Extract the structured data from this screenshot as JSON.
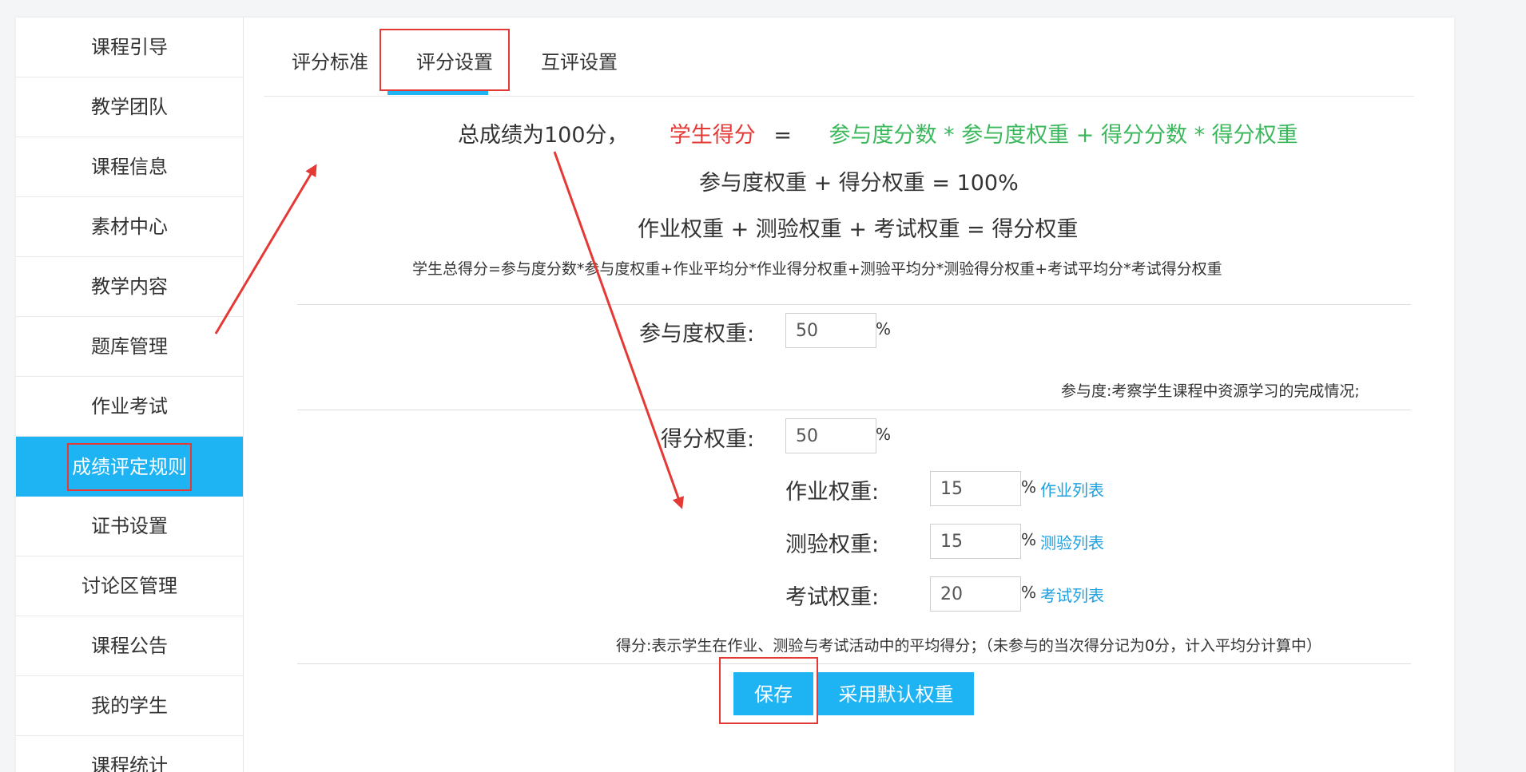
{
  "sidebar": {
    "items": [
      {
        "label": "课程引导",
        "active": false
      },
      {
        "label": "教学团队",
        "active": false
      },
      {
        "label": "课程信息",
        "active": false
      },
      {
        "label": "素材中心",
        "active": false
      },
      {
        "label": "教学内容",
        "active": false
      },
      {
        "label": "题库管理",
        "active": false
      },
      {
        "label": "作业考试",
        "active": false
      },
      {
        "label": "成绩评定规则",
        "active": true
      },
      {
        "label": "证书设置",
        "active": false
      },
      {
        "label": "讨论区管理",
        "active": false
      },
      {
        "label": "课程公告",
        "active": false
      },
      {
        "label": "我的学生",
        "active": false
      },
      {
        "label": "课程统计",
        "active": false
      }
    ]
  },
  "tabs": [
    {
      "label": "评分标准",
      "active": false
    },
    {
      "label": "评分设置",
      "active": true
    },
    {
      "label": "互评设置",
      "active": false
    }
  ],
  "formula": {
    "line1_prefix": "总成绩为100分，",
    "line1_student": "学生得分",
    "line1_eq": "=",
    "line1_expr": "参与度分数 * 参与度权重 + 得分分数 * 得分权重",
    "line2": "参与度权重 + 得分权重 = 100%",
    "line3": "作业权重 + 测验权重 + 考试权重 = 得分权重",
    "line4": "学生总得分=参与度分数*参与度权重+作业平均分*作业得分权重+测验平均分*测验得分权重+考试平均分*考试得分权重"
  },
  "form": {
    "participation": {
      "label": "参与度权重:",
      "value": "50",
      "unit": "%"
    },
    "participation_note": "参与度:考察学生课程中资源学习的完成情况;",
    "score": {
      "label": "得分权重:",
      "value": "50",
      "unit": "%"
    },
    "homework": {
      "label": "作业权重:",
      "value": "15",
      "unit": "%",
      "link": "作业列表"
    },
    "quiz": {
      "label": "测验权重:",
      "value": "15",
      "unit": "%",
      "link": "测验列表"
    },
    "exam": {
      "label": "考试权重:",
      "value": "20",
      "unit": "%",
      "link": "考试列表"
    },
    "score_note": "得分:表示学生在作业、测验与考试活动中的平均得分；（未参与的当次得分记为0分，计入平均分计算中）"
  },
  "buttons": {
    "save": "保存",
    "default": "采用默认权重"
  },
  "colors": {
    "accent": "#1eb3f2",
    "annotation": "#e53935",
    "formula_green": "#3cb85c",
    "link": "#1e9fe0"
  }
}
